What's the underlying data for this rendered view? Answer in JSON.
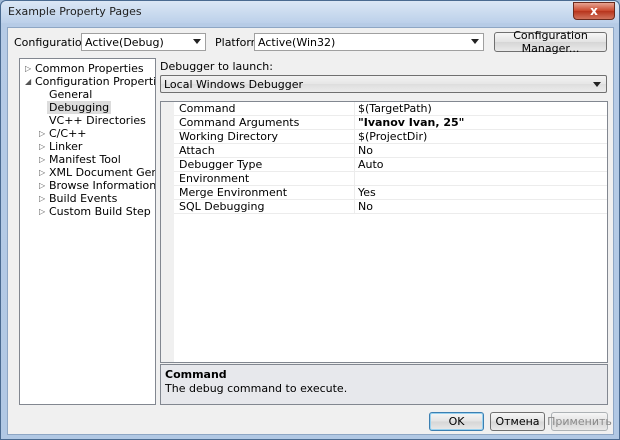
{
  "window": {
    "title": "Example Property Pages",
    "close_glyph": "x"
  },
  "config_bar": {
    "configuration_label": "Configuration:",
    "configuration_value": "Active(Debug)",
    "platform_label": "Platform:",
    "platform_value": "Active(Win32)",
    "config_manager_button": "Configuration Manager..."
  },
  "tree": {
    "items": [
      {
        "label": "Common Properties",
        "expander": "▷"
      },
      {
        "label": "Configuration Properties",
        "expander": "◢"
      },
      {
        "label": "General",
        "expander": ""
      },
      {
        "label": "Debugging",
        "expander": "",
        "selected": true
      },
      {
        "label": "VC++ Directories",
        "expander": ""
      },
      {
        "label": "C/C++",
        "expander": "▷"
      },
      {
        "label": "Linker",
        "expander": "▷"
      },
      {
        "label": "Manifest Tool",
        "expander": "▷"
      },
      {
        "label": "XML Document Generator",
        "expander": "▷"
      },
      {
        "label": "Browse Information",
        "expander": "▷"
      },
      {
        "label": "Build Events",
        "expander": "▷"
      },
      {
        "label": "Custom Build Step",
        "expander": "▷"
      }
    ]
  },
  "debugger": {
    "launch_label": "Debugger to launch:",
    "launch_value": "Local Windows Debugger"
  },
  "properties": [
    {
      "name": "Command",
      "value": "$(TargetPath)"
    },
    {
      "name": "Command Arguments",
      "value": "\"Ivanov Ivan, 25\"",
      "bold": true
    },
    {
      "name": "Working Directory",
      "value": "$(ProjectDir)"
    },
    {
      "name": "Attach",
      "value": "No"
    },
    {
      "name": "Debugger Type",
      "value": "Auto"
    },
    {
      "name": "Environment",
      "value": ""
    },
    {
      "name": "Merge Environment",
      "value": "Yes"
    },
    {
      "name": "SQL Debugging",
      "value": "No"
    }
  ],
  "description": {
    "title": "Command",
    "text": "The debug command to execute."
  },
  "buttons": {
    "ok": "OK",
    "cancel": "Отмена",
    "apply": "Применить"
  }
}
